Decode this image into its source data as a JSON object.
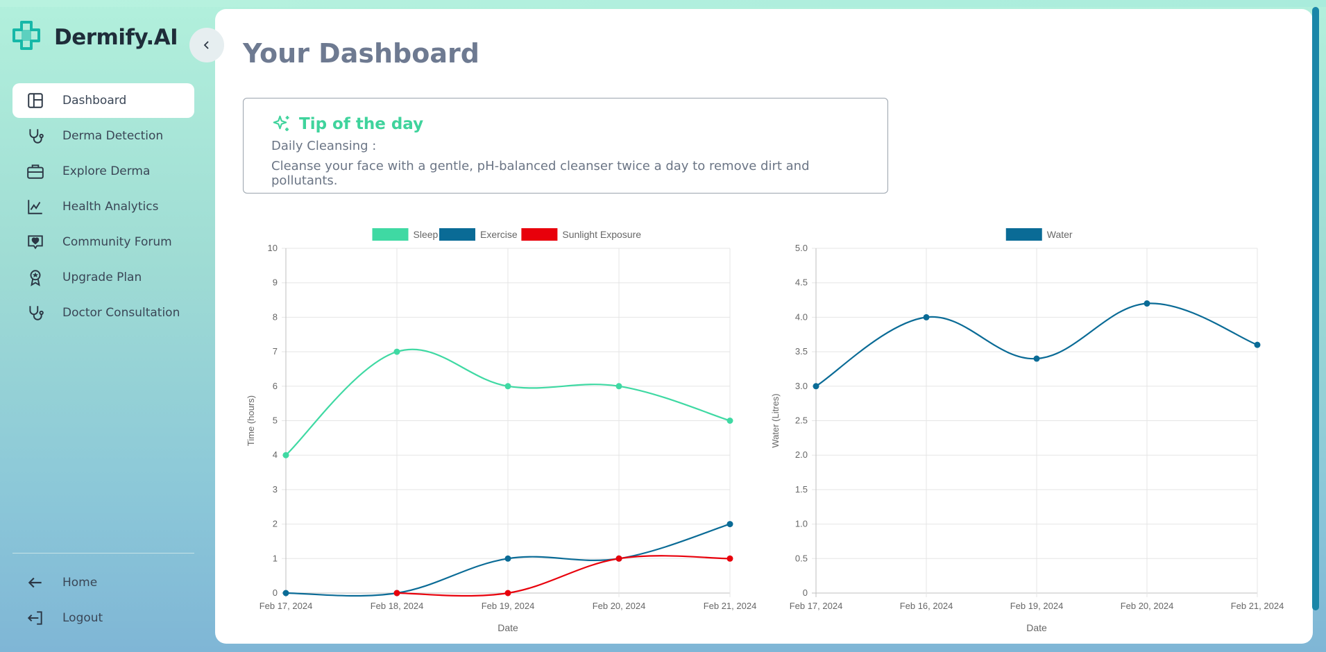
{
  "brand": {
    "name": "Dermify.AI",
    "logo_icon": "medical-cross-logo-icon"
  },
  "colors": {
    "accent": "#3fd39c",
    "brand_teal": "#17b8a8",
    "blue": "#0a6b96",
    "red": "#e8000b",
    "title": "#6e7a91"
  },
  "sidebar": {
    "collapse_icon": "chevron-left-icon",
    "items": [
      {
        "label": "Dashboard",
        "icon": "layout-icon",
        "active": true
      },
      {
        "label": "Derma Detection",
        "icon": "stethoscope-icon"
      },
      {
        "label": "Explore Derma",
        "icon": "briefcase-icon"
      },
      {
        "label": "Health Analytics",
        "icon": "line-chart-icon"
      },
      {
        "label": "Community Forum",
        "icon": "heart-message-icon"
      },
      {
        "label": "Upgrade Plan",
        "icon": "award-icon"
      },
      {
        "label": "Doctor Consultation",
        "icon": "stethoscope-icon"
      }
    ],
    "bottom": [
      {
        "label": "Home",
        "icon": "arrow-left-icon"
      },
      {
        "label": "Logout",
        "icon": "logout-icon"
      }
    ]
  },
  "main": {
    "title": "Your Dashboard",
    "tip": {
      "title": "Tip of the day",
      "icon": "sparkles-icon",
      "subtitle": "Daily Cleansing :",
      "text": "Cleanse your face with a gentle, pH-balanced cleanser twice a day to remove dirt and pollutants."
    }
  },
  "chart_data": [
    {
      "type": "line",
      "title": "",
      "xlabel": "Date",
      "ylabel": "Time (hours)",
      "ylim": [
        0,
        10
      ],
      "yticks": [
        "0",
        "1",
        "2",
        "3",
        "4",
        "5",
        "6",
        "7",
        "8",
        "9",
        "10"
      ],
      "categories": [
        "Feb 17, 2024",
        "Feb 18, 2024",
        "Feb 19, 2024",
        "Feb 20, 2024",
        "Feb 21, 2024"
      ],
      "legend_position": "top",
      "grid": true,
      "series": [
        {
          "name": "Sleep",
          "color": "#3fd9a3",
          "values": [
            4,
            7,
            6,
            6,
            5
          ]
        },
        {
          "name": "Exercise",
          "color": "#0a6b96",
          "values": [
            0,
            0,
            1,
            1,
            2
          ]
        },
        {
          "name": "Sunlight Exposure",
          "color": "#e8000b",
          "values": [
            null,
            0,
            0,
            1,
            1
          ]
        }
      ]
    },
    {
      "type": "line",
      "title": "",
      "xlabel": "Date",
      "ylabel": "Water (Litres)",
      "ylim": [
        0,
        5
      ],
      "yticks": [
        "0",
        "0.5",
        "1.0",
        "1.5",
        "2.0",
        "2.5",
        "3.0",
        "3.5",
        "4.0",
        "4.5",
        "5.0"
      ],
      "categories": [
        "Feb 17, 2024",
        "Feb 16, 2024",
        "Feb 19, 2024",
        "Feb 20, 2024",
        "Feb 21, 2024"
      ],
      "legend_position": "top",
      "grid": true,
      "series": [
        {
          "name": "Water",
          "color": "#0a6b96",
          "values": [
            3.0,
            4.0,
            3.4,
            4.2,
            3.6
          ]
        }
      ]
    }
  ]
}
